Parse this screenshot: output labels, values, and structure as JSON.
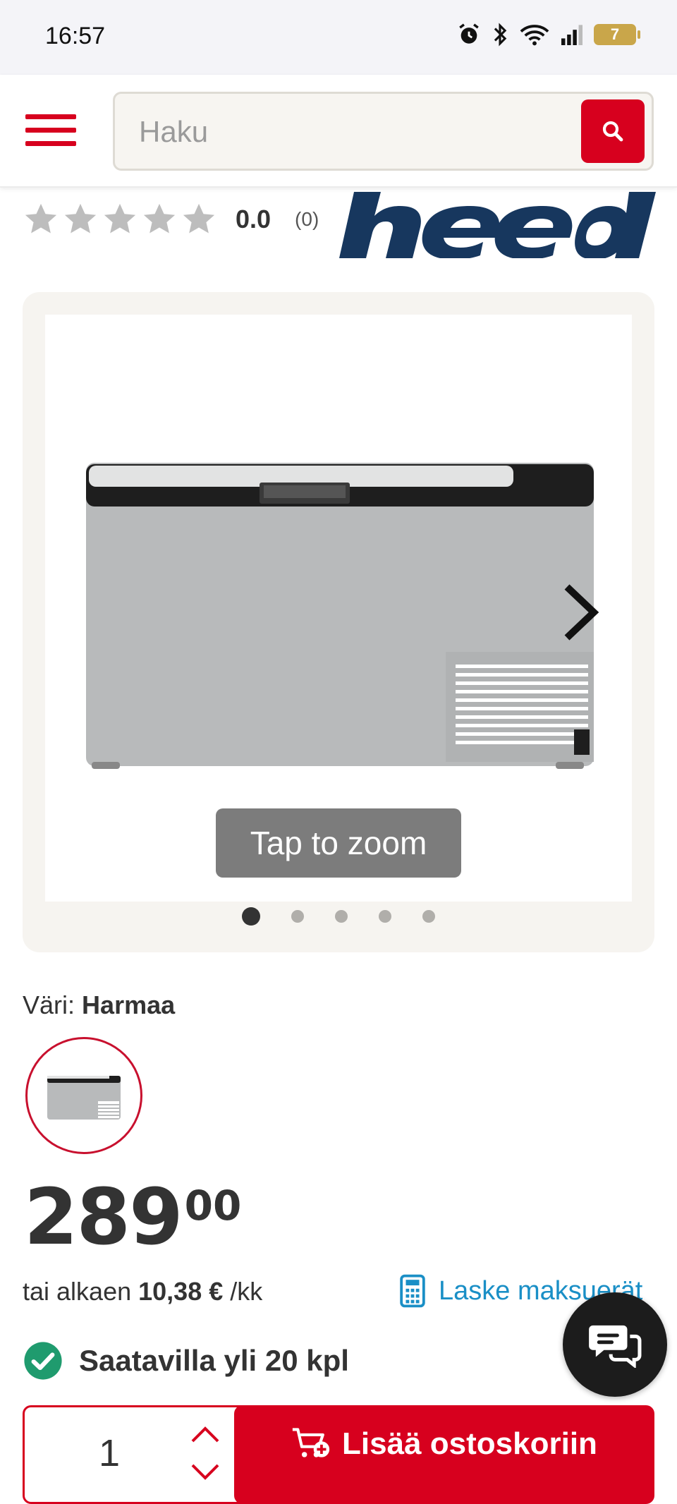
{
  "status_bar": {
    "time": "16:57",
    "battery": "7",
    "icons": [
      "alarm-icon",
      "bluetooth-icon",
      "wifi-icon",
      "signal-icon",
      "battery-icon"
    ]
  },
  "header": {
    "menu_icon": "hamburger-menu-icon",
    "search": {
      "placeholder": "Haku",
      "value": ""
    },
    "search_icon": "search-icon"
  },
  "product": {
    "rating": {
      "value": "0.0",
      "count": "(0)",
      "stars_filled": 0,
      "stars_total": 5
    },
    "brand": "heed",
    "gallery": {
      "zoom_hint": "Tap to zoom",
      "image_count": 5,
      "active_index": 0
    },
    "color": {
      "label": "Väri:",
      "value": "Harmaa"
    },
    "price": {
      "main": "289",
      "cents": "00"
    },
    "financing": {
      "prefix": "tai alkaen",
      "amount": "10,38 €",
      "suffix": "/kk"
    },
    "calc_link": "Laske maksuerät",
    "availability": "Saatavilla yli 20 kpl",
    "quantity": "1",
    "add_to_cart": "Lisää ostoskoriin"
  },
  "colors": {
    "brand_red": "#d7001e",
    "brand_blue": "#17375e",
    "link_blue": "#1a8fc6",
    "success_green": "#1f9b6e"
  }
}
